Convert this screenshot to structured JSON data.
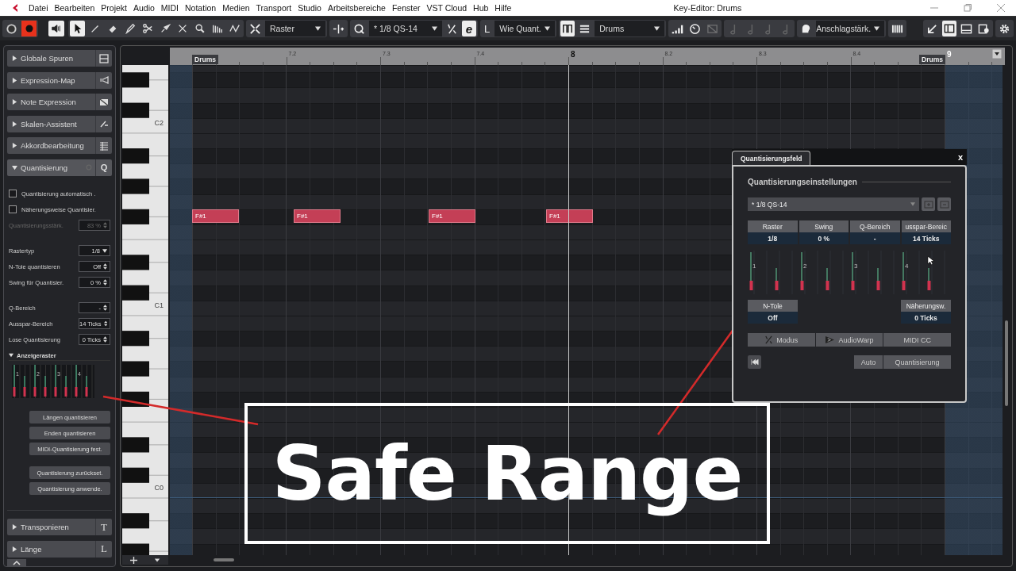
{
  "menubar": {
    "items": [
      "Datei",
      "Bearbeiten",
      "Projekt",
      "Audio",
      "MIDI",
      "Notation",
      "Medien",
      "Transport",
      "Studio",
      "Arbeitsbereiche",
      "Fenster",
      "VST Cloud",
      "Hub",
      "Hilfe"
    ],
    "title": "Key-Editor: Drums"
  },
  "toolbar": {
    "record": true,
    "tools": [
      {
        "selected": true
      },
      {
        "selected": false
      },
      {
        "selected": false
      },
      {
        "selected": false
      },
      {
        "selected": false
      },
      {
        "selected": false
      },
      {
        "selected": false
      },
      {
        "selected": false
      },
      {
        "selected": false
      },
      {
        "selected": false
      }
    ],
    "grid_type": "Raster",
    "quantize_preset": "* 1/8  QS-14",
    "iterative_glyph": "e",
    "length_glyph": "L",
    "length": "Wie Quant.",
    "track": "Drums",
    "controller": "Anschlagstärk."
  },
  "inspector": {
    "sections": [
      {
        "label": "Globale Spuren",
        "expanded": false
      },
      {
        "label": "Expression-Map",
        "expanded": false
      },
      {
        "label": "Note Expression",
        "expanded": false
      },
      {
        "label": "Skalen-Assistent",
        "expanded": false
      },
      {
        "label": "Akkordbearbeitung",
        "expanded": false
      },
      {
        "label": "Quantisierung",
        "expanded": true,
        "glyph": "Q"
      },
      {
        "label": "Transponieren",
        "expanded": false,
        "glyph": "T"
      },
      {
        "label": "Länge",
        "expanded": false,
        "glyph": "L"
      }
    ],
    "quantize": {
      "checkboxes": [
        {
          "label": "Quantisierung automatisch .",
          "checked": false
        },
        {
          "label": "Näherungsweise Quantisier.",
          "checked": false
        }
      ],
      "strength": {
        "label": "Quantisierungsstärk.",
        "value": "83 %",
        "disabled": true
      },
      "settings": [
        {
          "label": "Rastertyp",
          "value": "1/8",
          "kind": "dropdown"
        },
        {
          "label": "N-Tole quantisieren",
          "value": "Off",
          "kind": "spinner"
        },
        {
          "label": "Swing für Quantisier.",
          "value": "0 %",
          "kind": "spinner"
        }
      ],
      "range_settings": [
        {
          "label": "Q-Bereich",
          "value": "-",
          "kind": "spinner"
        },
        {
          "label": "Ausspar-Bereich",
          "value": "14 Ticks",
          "kind": "spinner"
        },
        {
          "label": "Lose Quantisierung",
          "value": "0 Ticks",
          "kind": "spinner"
        }
      ],
      "grid_display": {
        "label": "Anzeigeraster",
        "expanded": true,
        "beats": [
          "1",
          "2",
          "3",
          "4"
        ]
      },
      "buttons": [
        "Längen quantisieren",
        "Enden quantisieren",
        "MIDI-Quantisierung fest."
      ],
      "reset_buttons": [
        "Quantisierung zurückset.",
        "Quantisierung anwende."
      ]
    }
  },
  "ruler": {
    "part_start": "Drums",
    "marks": [
      "7.2",
      "7.3",
      "7.4",
      "8",
      "8.2",
      "8.3",
      "8.4"
    ],
    "part_end": "Drums",
    "next_bar": "9"
  },
  "keyboard": {
    "labels": [
      "C2",
      "C1",
      "C0"
    ]
  },
  "notes": [
    {
      "label": "F#1"
    },
    {
      "label": "F#1"
    },
    {
      "label": "F#1"
    },
    {
      "label": "F#1"
    }
  ],
  "quantize_window": {
    "tab": "Quantisierungsfeld",
    "close": "x",
    "heading": "Quantisierungseinstellungen",
    "preset": "* 1/8  QS-14",
    "params": [
      {
        "label": "Raster",
        "value": "1/8"
      },
      {
        "label": "Swing",
        "value": "0 %"
      },
      {
        "label": "Q-Bereich",
        "value": "-"
      },
      {
        "label": "usspar-Bereic",
        "value": "14 Ticks"
      }
    ],
    "beats": [
      "1",
      "2",
      "3",
      "4"
    ],
    "tuplet": {
      "label": "N-Tole",
      "value": "Off"
    },
    "approx": {
      "label": "Näherungsw.",
      "value": "0 Ticks"
    },
    "modes": [
      "Modus",
      "AudioWarp",
      "MIDI CC"
    ],
    "auto": "Auto",
    "apply": "Quantisierung"
  },
  "caption": "Safe Range"
}
